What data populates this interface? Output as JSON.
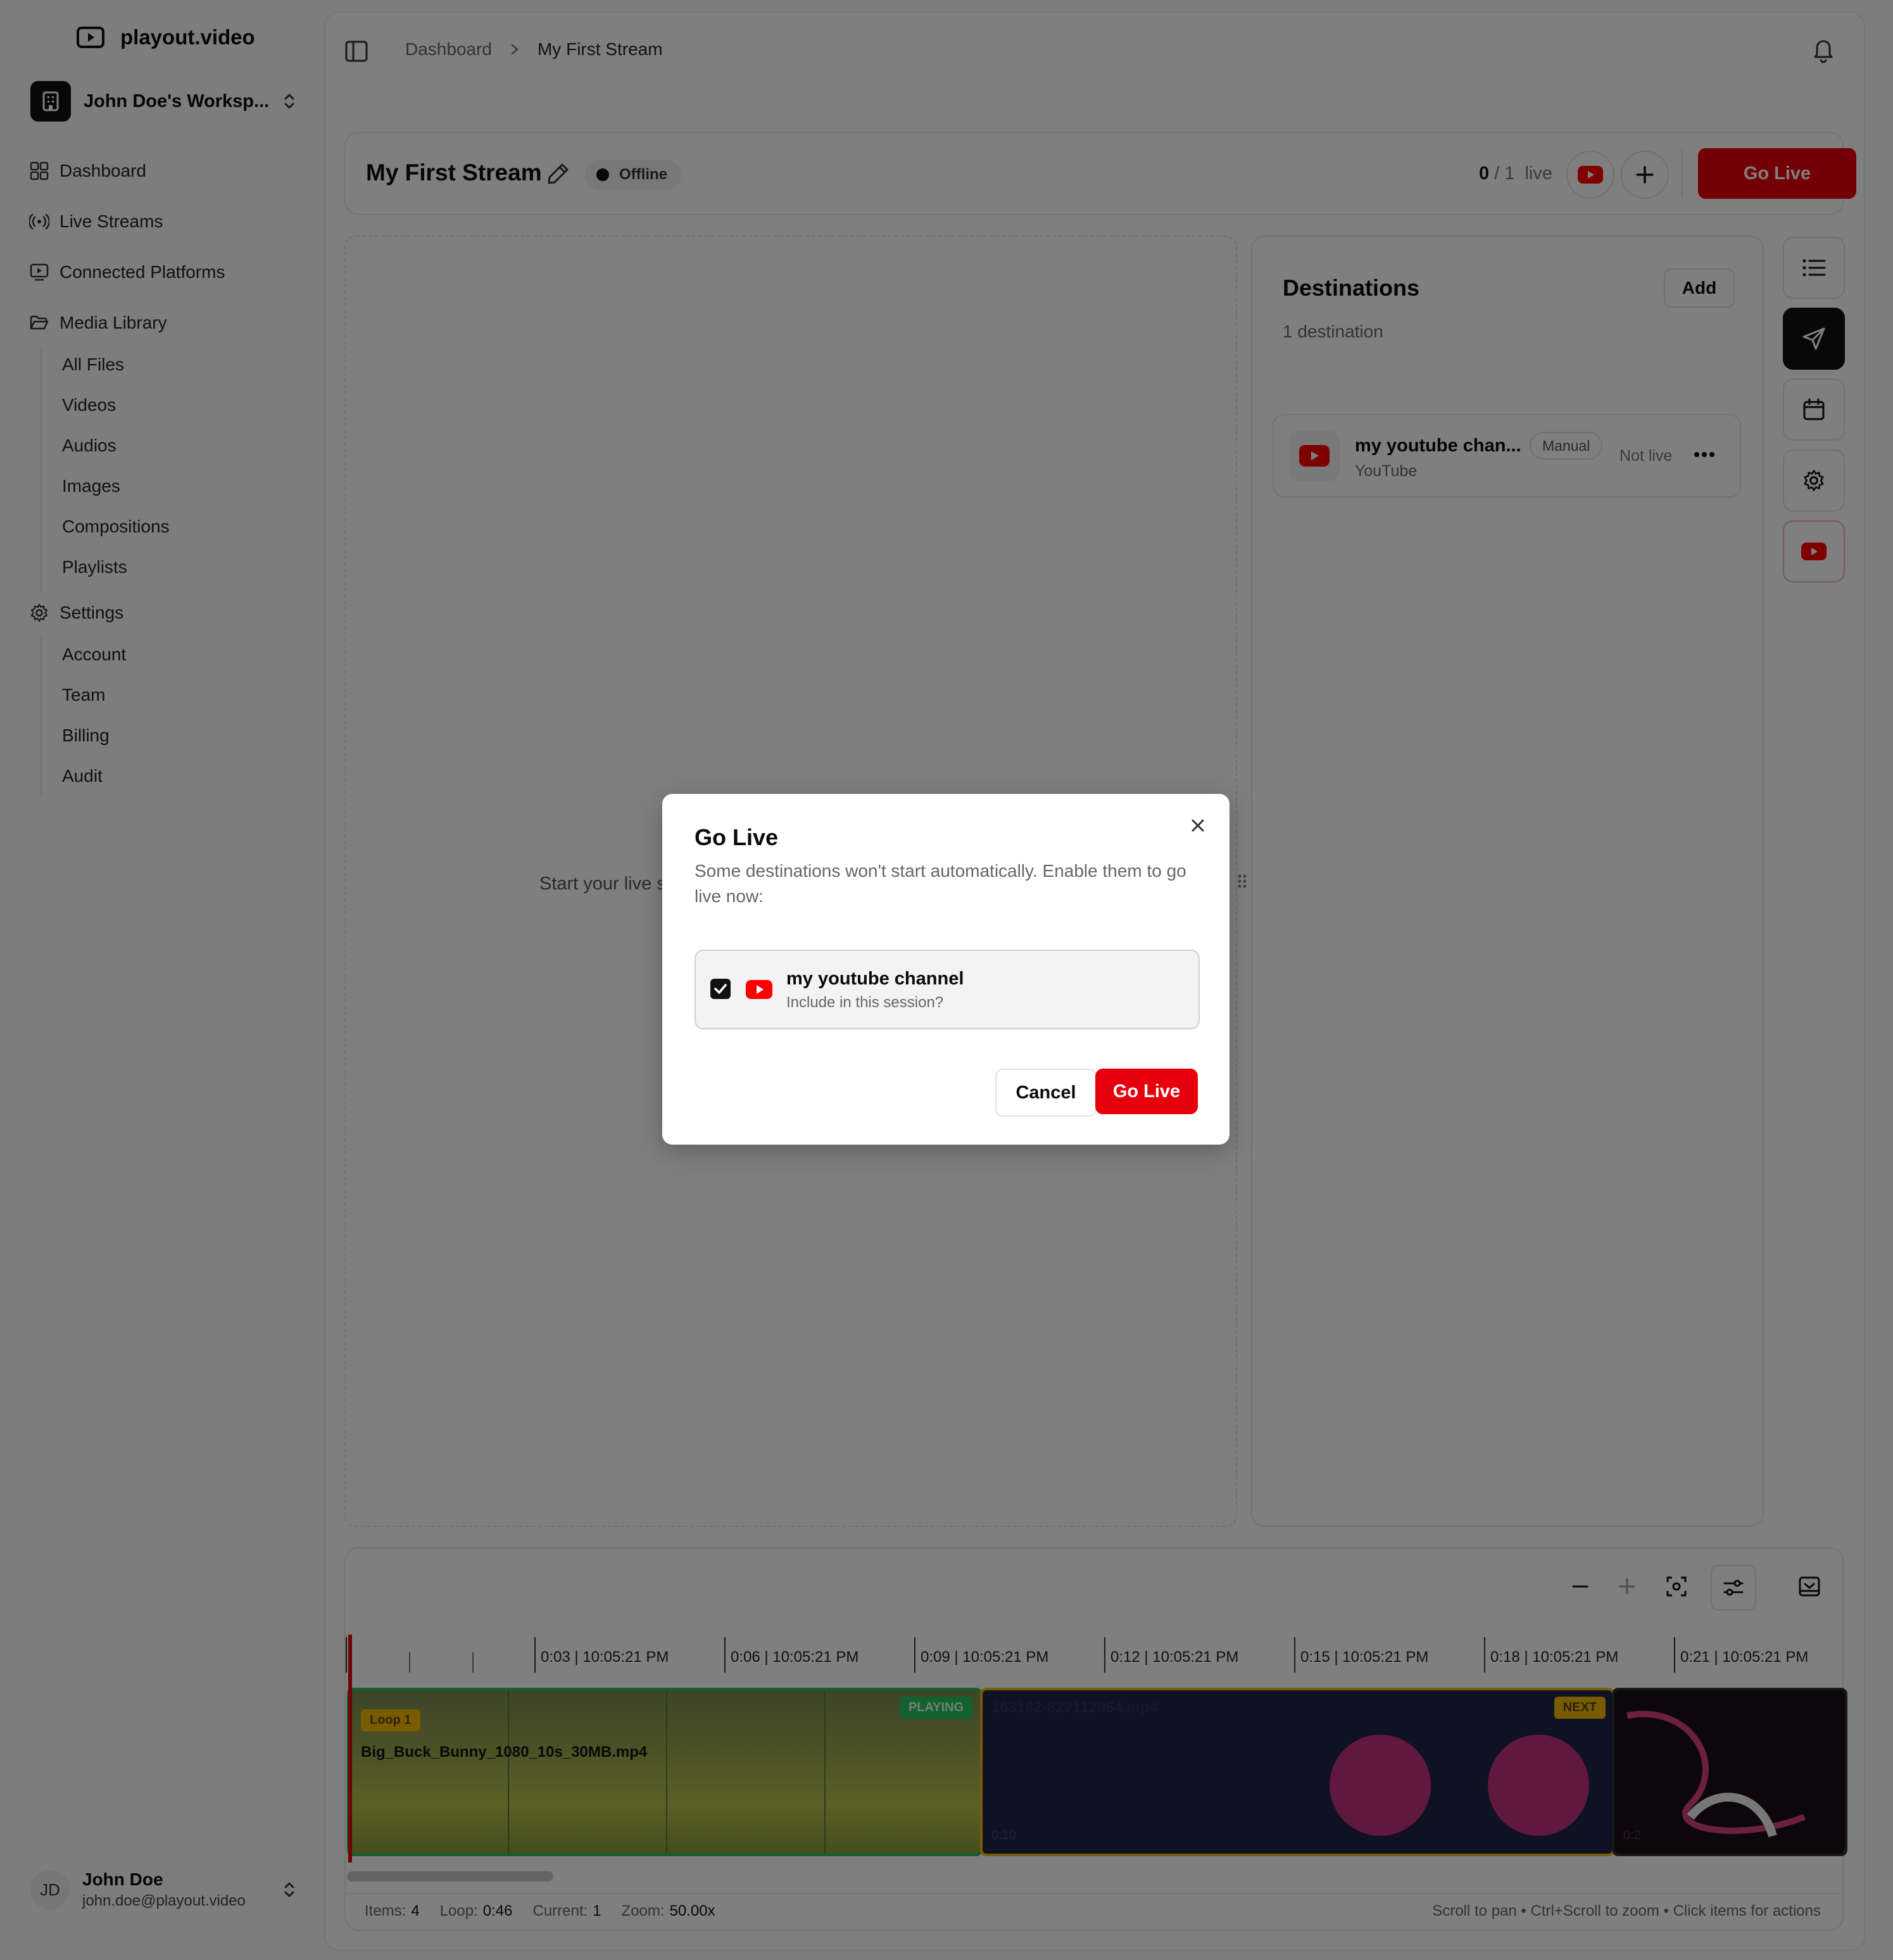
{
  "app": {
    "name": "playout.video"
  },
  "workspace": {
    "name": "John Doe's Worksp..."
  },
  "nav": {
    "dashboard": "Dashboard",
    "live_streams": "Live Streams",
    "connected_platforms": "Connected Platforms",
    "media_library": "Media Library",
    "media_items": [
      "All Files",
      "Videos",
      "Audios",
      "Images",
      "Compositions",
      "Playlists"
    ],
    "settings": "Settings",
    "settings_items": [
      "Account",
      "Team",
      "Billing",
      "Audit"
    ]
  },
  "user": {
    "initials": "JD",
    "name": "John Doe",
    "email": "john.doe@playout.video"
  },
  "breadcrumb": {
    "root": "Dashboard",
    "current": "My First Stream"
  },
  "stream": {
    "title": "My First Stream",
    "status": "Offline",
    "live_now": "0",
    "live_sep": "/ 1",
    "live_label": "live",
    "go_live_label": "Go Live"
  },
  "preview": {
    "text": "Start your live s"
  },
  "destinations": {
    "title": "Destinations",
    "add_label": "Add",
    "count_text": "1 destination",
    "items": [
      {
        "name": "my youtube chan...",
        "platform": "YouTube",
        "mode": "Manual",
        "status": "Not live"
      }
    ]
  },
  "timeline": {
    "ruler": [
      "0:03 | 10:05:21 PM",
      "0:06 | 10:05:21 PM",
      "0:09 | 10:05:21 PM",
      "0:12 | 10:05:21 PM",
      "0:15 | 10:05:21 PM",
      "0:18 | 10:05:21 PM",
      "0:21 | 10:05:21 PM"
    ],
    "clips": [
      {
        "name": "Big_Buck_Bunny_1080_10s_30MB.mp4",
        "loop_tag": "Loop 1",
        "state": "PLAYING"
      },
      {
        "name": "163182-827112954.mp4",
        "state": "NEXT",
        "time": "0:10"
      },
      {
        "time": "0:2"
      }
    ],
    "status": {
      "items_label": "Items:",
      "items_value": "4",
      "loop_label": "Loop:",
      "loop_value": "0:46",
      "current_label": "Current:",
      "current_value": "1",
      "zoom_label": "Zoom:",
      "zoom_value": "50.00x",
      "hint": "Scroll to pan • Ctrl+Scroll to zoom • Click items for actions"
    }
  },
  "modal": {
    "title": "Go Live",
    "description": "Some destinations won't start automatically. Enable them to go live now:",
    "option": {
      "name": "my youtube channel",
      "subtitle": "Include in this session?",
      "checked": true
    },
    "cancel_label": "Cancel",
    "confirm_label": "Go Live"
  },
  "colors": {
    "accent": "#e7000b",
    "youtube": "#ff0000",
    "playing": "#22c55e",
    "next": "#f5b800"
  }
}
